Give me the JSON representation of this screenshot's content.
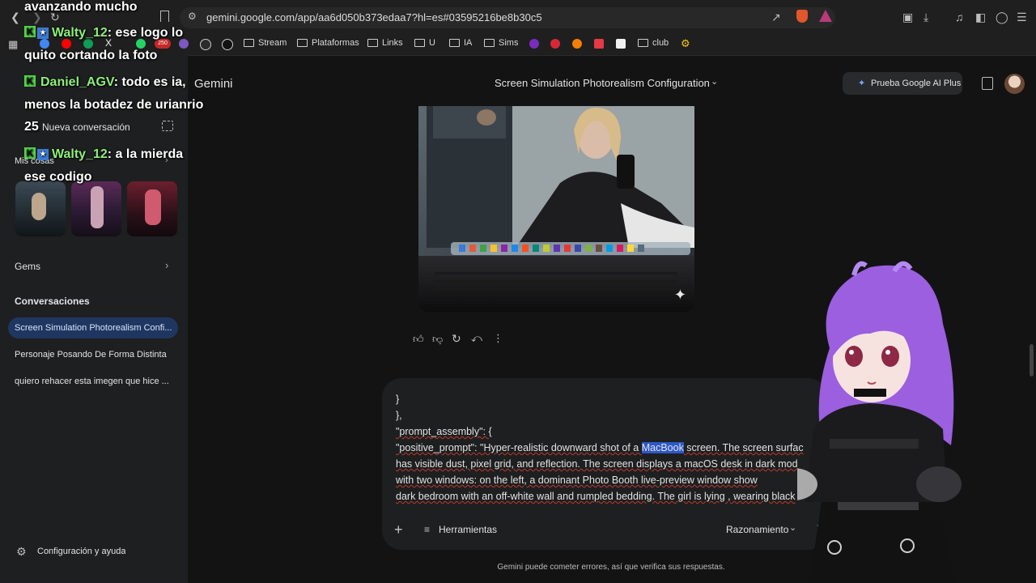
{
  "browser": {
    "url": "gemini.google.com/app/aa6d050b373edaa7?hl=es#03595216be8b30c5",
    "bookmarks": [
      {
        "label": "Stream"
      },
      {
        "label": "Plataformas"
      },
      {
        "label": "Links"
      },
      {
        "label": "U"
      },
      {
        "label": "IA"
      },
      {
        "label": "Sims"
      },
      {
        "label": "club"
      }
    ],
    "badge_count": "250"
  },
  "sidebar": {
    "app_name": "Gemini",
    "new_chat": "Nueva conversación",
    "my_stuff": "Mis cosas",
    "gems": "Gems",
    "conversations_heading": "Conversaciones",
    "conversations": [
      "Screen Simulation Photorealism Confi...",
      "Personaje Posando De Forma Distinta",
      "quiero rehacer esta imegen que hice ..."
    ],
    "settings": "Configuración y ayuda"
  },
  "header": {
    "title": "Screen Simulation Photorealism Configuration",
    "upgrade": "Prueba Google AI Plus"
  },
  "composer": {
    "lines": [
      "}",
      "},",
      "\"prompt_assembly\": {"
    ],
    "line4_pre": "\"positive_prompt\": \"Hyper-realistic downward shot of a ",
    "line4_sel": "MacBook",
    "line4_post": " screen. The screen surfac",
    "line5": "has visible dust, pixel grid, and reflection. The screen displays a macOS desk        in dark mod",
    "line6": "with two windows: on the left, a dominant Photo Booth live-preview window show",
    "line7": "dark bedroom with an off-white wall and rumpled bedding. The girl is lying , wearing black",
    "tools": "Herramientas",
    "mode": "Razonamiento"
  },
  "footer": "Gemini puede cometer errores, así que verifica sus respuestas.",
  "chat_overlay": {
    "line0": "avanzando mucho",
    "m1_user": "Walty_12",
    "m1_text": ": ese logo lo",
    "m1_text2": "quito cortando la foto",
    "m2_user": "Daniel_AGV",
    "m2_text": ": todo es ia,",
    "m2_text2": "menos la botadez de urianrio",
    "m2_text3": "25",
    "m3_user": "Walty_12",
    "m3_text": ": a la mierda",
    "m3_text2": "ese codigo"
  }
}
